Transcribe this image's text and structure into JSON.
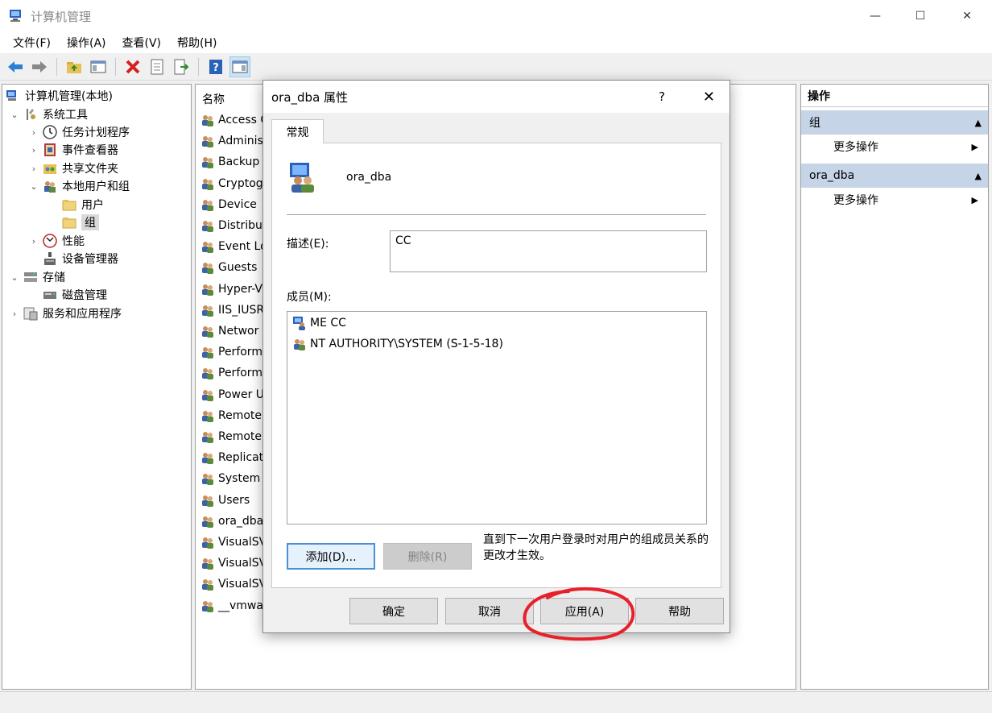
{
  "window": {
    "title": "计算机管理",
    "minimize": "—",
    "maximize": "☐",
    "close": "✕"
  },
  "menu": [
    {
      "label": "文件(F)"
    },
    {
      "label": "操作(A)"
    },
    {
      "label": "查看(V)"
    },
    {
      "label": "帮助(H)"
    }
  ],
  "tree": [
    {
      "label": "计算机管理(本地)",
      "caret": "",
      "icon": "computer-management-icon"
    },
    {
      "label": "系统工具",
      "caret": "⌄",
      "icon": "system-tools-icon"
    },
    {
      "label": "任务计划程序",
      "caret": "›",
      "icon": "task-scheduler-icon"
    },
    {
      "label": "事件查看器",
      "caret": "›",
      "icon": "event-viewer-icon"
    },
    {
      "label": "共享文件夹",
      "caret": "›",
      "icon": "shared-folders-icon"
    },
    {
      "label": "本地用户和组",
      "caret": "⌄",
      "icon": "local-users-groups-icon"
    },
    {
      "label": "用户",
      "caret": "",
      "icon": "folder-icon"
    },
    {
      "label": "组",
      "caret": "",
      "icon": "folder-icon"
    },
    {
      "label": "性能",
      "caret": "›",
      "icon": "performance-icon"
    },
    {
      "label": "设备管理器",
      "caret": "",
      "icon": "device-manager-icon"
    },
    {
      "label": "存储",
      "caret": "⌄",
      "icon": "storage-icon"
    },
    {
      "label": "磁盘管理",
      "caret": "",
      "icon": "disk-management-icon"
    },
    {
      "label": "服务和应用程序",
      "caret": "›",
      "icon": "services-apps-icon"
    }
  ],
  "list": {
    "header": "名称",
    "rows": [
      "Access C",
      "Adminis",
      "Backup",
      "Cryptog",
      "Device",
      "Distribut",
      "Event Lo",
      "Guests",
      "Hyper-V",
      "IIS_IUSR",
      "Networ",
      "Perform",
      "Perform",
      "Power U",
      "Remote",
      "Remote",
      "Replicat",
      "System",
      "Users",
      "ora_dba",
      "VisualSV",
      "VisualSV",
      "VisualSV",
      "__vmwa"
    ]
  },
  "actions": {
    "title": "操作",
    "groups": [
      {
        "label": "组",
        "item": "更多操作"
      },
      {
        "label": "ora_dba",
        "item": "更多操作"
      }
    ]
  },
  "dialog": {
    "title": "ora_dba 属性",
    "help": "?",
    "close": "✕",
    "tab": "常规",
    "group_name": "ora_dba",
    "desc_label": "描述(E):",
    "desc_value": "CC",
    "members_label": "成员(M):",
    "members": [
      {
        "name": "ME CC",
        "icon": "user-icon"
      },
      {
        "name": "NT AUTHORITY\\SYSTEM (S-1-5-18)",
        "icon": "group-icon"
      }
    ],
    "add_button": "添加(D)...",
    "remove_button": "删除(R)",
    "note": "直到下一次用户登录时对用户的组成员关系的更改才生效。",
    "ok_button": "确定",
    "cancel_button": "取消",
    "apply_button": "应用(A)",
    "help_button": "帮助"
  },
  "annotation_color": "#e8202a"
}
